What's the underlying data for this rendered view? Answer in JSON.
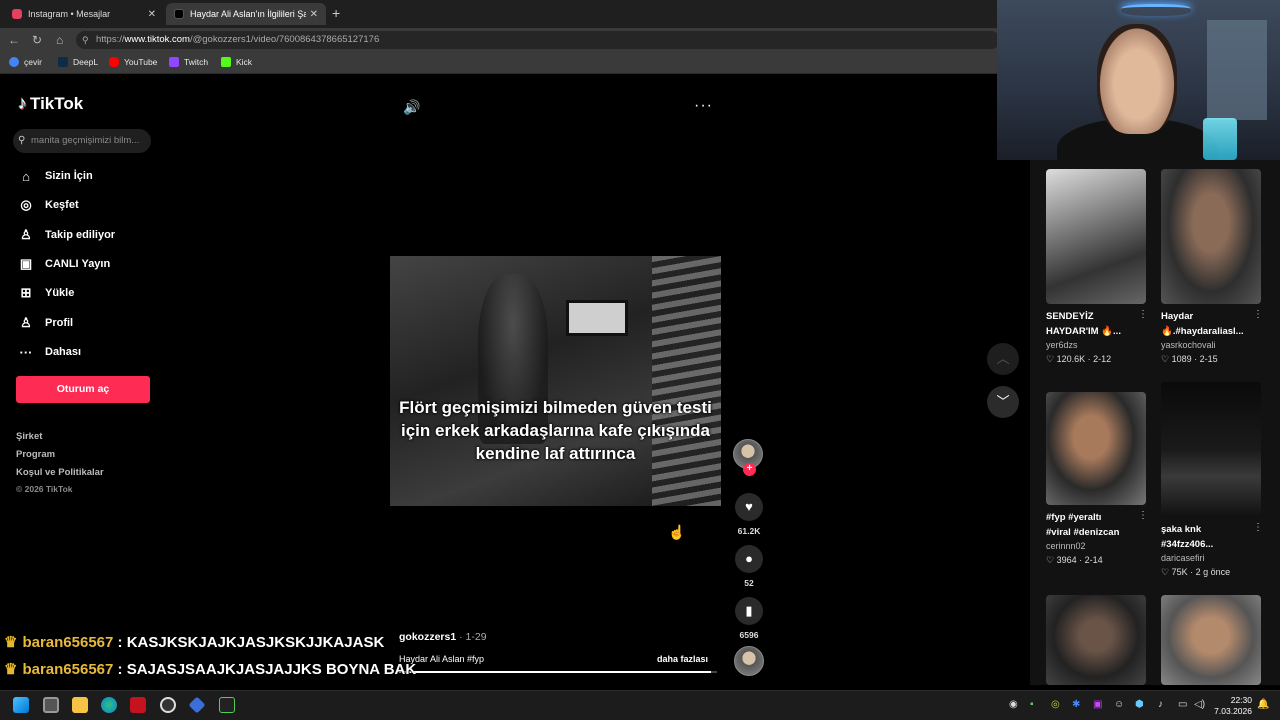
{
  "browser": {
    "tabs": [
      {
        "title": "Instagram • Mesajlar",
        "icon": "instagram-icon",
        "color": "#e4405f"
      },
      {
        "title": "Haydar Ali Aslan'ın İlgilileri Şaşkına",
        "icon": "tiktok-icon",
        "color": "#000000"
      }
    ],
    "url_prefix": "https://",
    "url_host": "www.tiktok.com",
    "url_path": "/@gokozzers1/video/7600864378665127176",
    "bookmarks": [
      {
        "label": "çevir",
        "icon": "google-icon",
        "color": "#4285f4"
      },
      {
        "label": "DeepL",
        "icon": "deepl-icon",
        "color": "#0f2b46"
      },
      {
        "label": "YouTube",
        "icon": "youtube-icon",
        "color": "#ff0000"
      },
      {
        "label": "Twitch",
        "icon": "twitch-icon",
        "color": "#9146ff"
      },
      {
        "label": "Kick",
        "icon": "kick-icon",
        "color": "#53fc18"
      }
    ]
  },
  "tiktok": {
    "logo": "TikTok",
    "search_placeholder": "manita geçmişimizi bilm...",
    "menu": [
      {
        "label": "Sizin İçin",
        "icon": "home-icon"
      },
      {
        "label": "Keşfet",
        "icon": "compass-icon"
      },
      {
        "label": "Takip ediliyor",
        "icon": "following-icon"
      },
      {
        "label": "CANLI Yayın",
        "icon": "live-icon"
      },
      {
        "label": "Yükle",
        "icon": "upload-icon"
      },
      {
        "label": "Profil",
        "icon": "profile-icon"
      },
      {
        "label": "Dahası",
        "icon": "more-icon"
      }
    ],
    "login_button": "Oturum aç",
    "footer": [
      "Şirket",
      "Program",
      "Koşul ve Politikalar"
    ],
    "copyright": "© 2026 TikTok",
    "accent": "#fe2c55"
  },
  "video": {
    "caption": "Flört geçmişimizi bilmeden güven testi için erkek arkadaşlarına kafe çıkışında kendine laf attırınca",
    "likes": "61.2K",
    "comments": "52",
    "saves": "6596",
    "author": "gokozzers1",
    "date": " · 1-29",
    "description": "Haydar Ali Aslan #fyp",
    "more_label": "daha fazlası",
    "progress": 0.98
  },
  "chat": [
    {
      "user": "baran656567",
      "message": " : KASJKSKJAJKJASJKSKJJKAJASK"
    },
    {
      "user": "baran656567",
      "message": " : SAJASJSAAJKJASJAJJKS BOYNA BAK"
    }
  ],
  "recommended": [
    {
      "title": "SENDEYİZ\nHAYDAR'IM 🔥...",
      "user": "yer6dzs",
      "likes": "120.6K",
      "date": "2-12"
    },
    {
      "title": "Haydar\n🔥.#haydaraliasl...",
      "user": "yasrkochovali",
      "likes": "1089",
      "date": "2-15"
    },
    {
      "title": "#fyp #yeraltı\n#viral #denizcan",
      "user": "cerinnn02",
      "likes": "3964",
      "date": "2-14"
    },
    {
      "title": "şaka knk\n#34fzz406...",
      "user": "daricasefiri",
      "likes": "75K",
      "date": "2 g önce"
    },
    {
      "title": "",
      "user": "",
      "likes": "",
      "date": ""
    },
    {
      "title": "",
      "user": "",
      "likes": "",
      "date": ""
    }
  ],
  "taskbar": {
    "time": "22:30",
    "date": "7.03.2026"
  }
}
